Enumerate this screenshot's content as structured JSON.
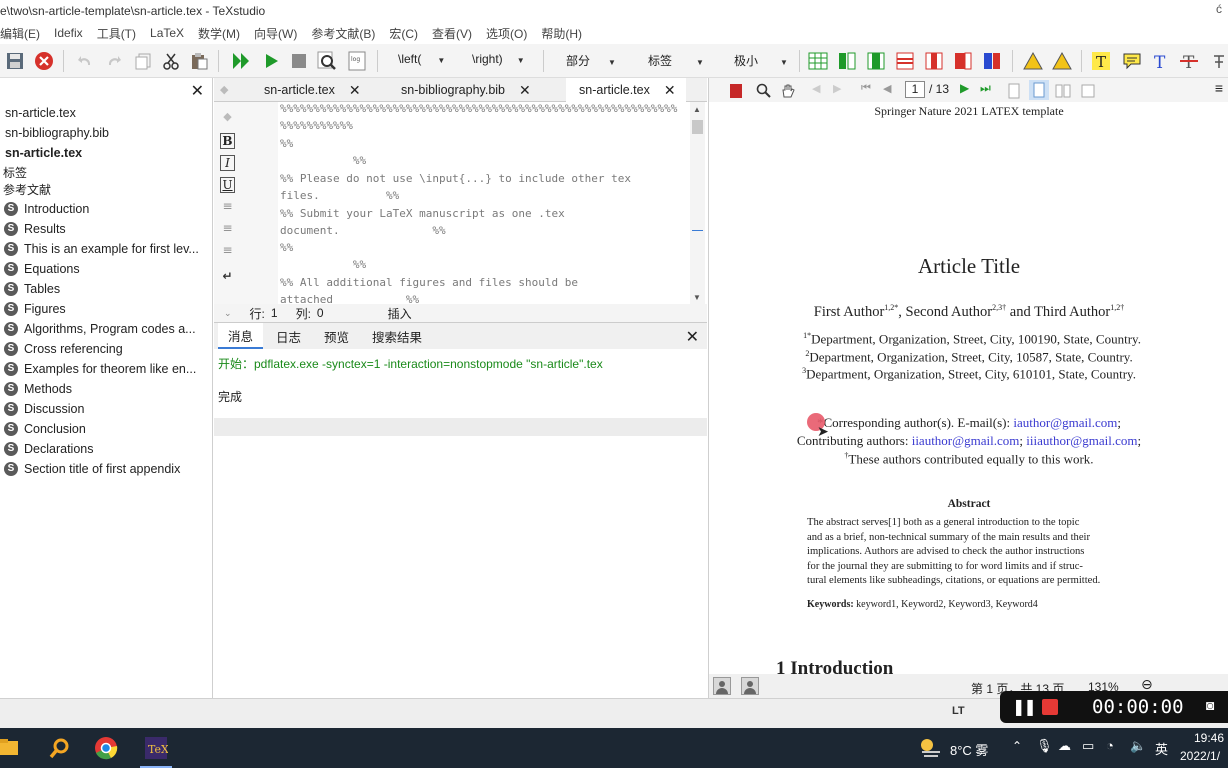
{
  "window": {
    "title": "e\\two\\sn-article-template\\sn-article.tex - TeXstudio",
    "corner": "ć"
  },
  "menu": [
    "编辑(E)",
    "Idefix",
    "工具(T)",
    "LaTeX",
    "数学(M)",
    "向导(W)",
    "参考文献(B)",
    "宏(C)",
    "查看(V)",
    "选项(O)",
    "帮助(H)"
  ],
  "toolbar": {
    "left_label": "\\left(",
    "right_label": "\\right)",
    "section_label": "部分",
    "ref_label": "标签",
    "size_label": "极小"
  },
  "structure": {
    "files": [
      "sn-article.tex",
      "sn-bibliography.bib",
      "sn-article.tex"
    ],
    "labels_header": "标签",
    "bib_header": "参考文献",
    "sections": [
      "Introduction",
      "Results",
      "This is an example for first lev...",
      "Equations",
      "Tables",
      "Figures",
      "Algorithms, Program codes a...",
      "Cross referencing",
      "Examples for theorem like en...",
      "Methods",
      "Discussion",
      "Conclusion",
      "Declarations",
      "Section title of first appendix"
    ]
  },
  "editor": {
    "tabs": [
      "sn-article.tex",
      "sn-bibliography.bib",
      "sn-article.tex"
    ],
    "code_lines": [
      "%%%%%%%%%%%%%%%%%%%%%%%%%%%%%%%%%%%%%%%%%%%%%%%%%%%%%%%%%%%%",
      "%%%%%%%%%%%",
      "%%",
      "           %%",
      "%% Please do not use \\input{...} to include other tex",
      "files.          %%",
      "%% Submit your LaTeX manuscript as one .tex",
      "document.              %%",
      "%%",
      "           %%",
      "%% All additional figures and files should be",
      "attached           %%"
    ],
    "status": {
      "line_label": "行:",
      "line_value": "1",
      "col_label": "列:",
      "col_value": "0",
      "mode": "插入"
    }
  },
  "messages": {
    "tabs": [
      "消息",
      "日志",
      "预览",
      "搜索结果"
    ],
    "command": "开始：pdflatex.exe -synctex=1 -interaction=nonstopmode \"sn-article\".tex",
    "done": "完成"
  },
  "pdf": {
    "page_input": "1",
    "page_total": "/ 13",
    "header": "Springer Nature 2021 LATEX template",
    "title": "Article Title",
    "authors": {
      "a1": "First Author",
      "a1_sup": "1,2*",
      "sep1": ", Second Author",
      "a2_sup": "2,3†",
      "sep2": " and Third Author",
      "a3_sup": "1,2†"
    },
    "affiliations": [
      {
        "sup": "1*",
        "text": "Department, Organization, Street, City, 100190, State, Country."
      },
      {
        "sup": "2",
        "text": "Department, Organization, Street, City, 10587, State, Country."
      },
      {
        "sup": "3",
        "text": "Department, Organization, Street, City, 610101, State, Country."
      }
    ],
    "corresponding_prefix": "*Corresponding author(s). E-mail(s): ",
    "corresponding_email": "iauthor@gmail.com",
    "corresponding_suffix": ";",
    "contrib_prefix": "Contributing authors: ",
    "contrib_email1": "iiauthor@gmail.com",
    "contrib_sep": "; ",
    "contrib_email2": "iiiauthor@gmail.com",
    "contrib_suffix": ";",
    "equal_sup": "†",
    "equal_text": "These authors contributed equally to this work.",
    "abstract_heading": "Abstract",
    "abstract_lines": [
      "The abstract serves[1] both as a general introduction to the topic",
      "and as a brief, non-technical summary of the main results and their",
      "implications. Authors are advised to check the author instructions",
      "for the journal they are submitting to for word limits and if struc-",
      "tural elements like subheadings, citations, or equations are permitted."
    ],
    "keywords_label": "Keywords:",
    "keywords": " keyword1, Keyword2, Keyword3, Keyword4",
    "section_heading": "1  Introduction",
    "status_page": "第 1 页，共 13 页",
    "zoom": "131%"
  },
  "recorder": {
    "time": "00:00:00"
  },
  "bottom": {
    "lt_label": "LT"
  },
  "taskbar": {
    "weather": "8°C 雾",
    "ime": "英",
    "time": "19:46",
    "date": "2022/1/"
  },
  "colors": {
    "accent": "#3a7bd5",
    "run_green": "#1f9a2a",
    "stop_red": "#d6312b",
    "link_blue": "#3a3ad0",
    "taskbar": "#1c2733"
  }
}
